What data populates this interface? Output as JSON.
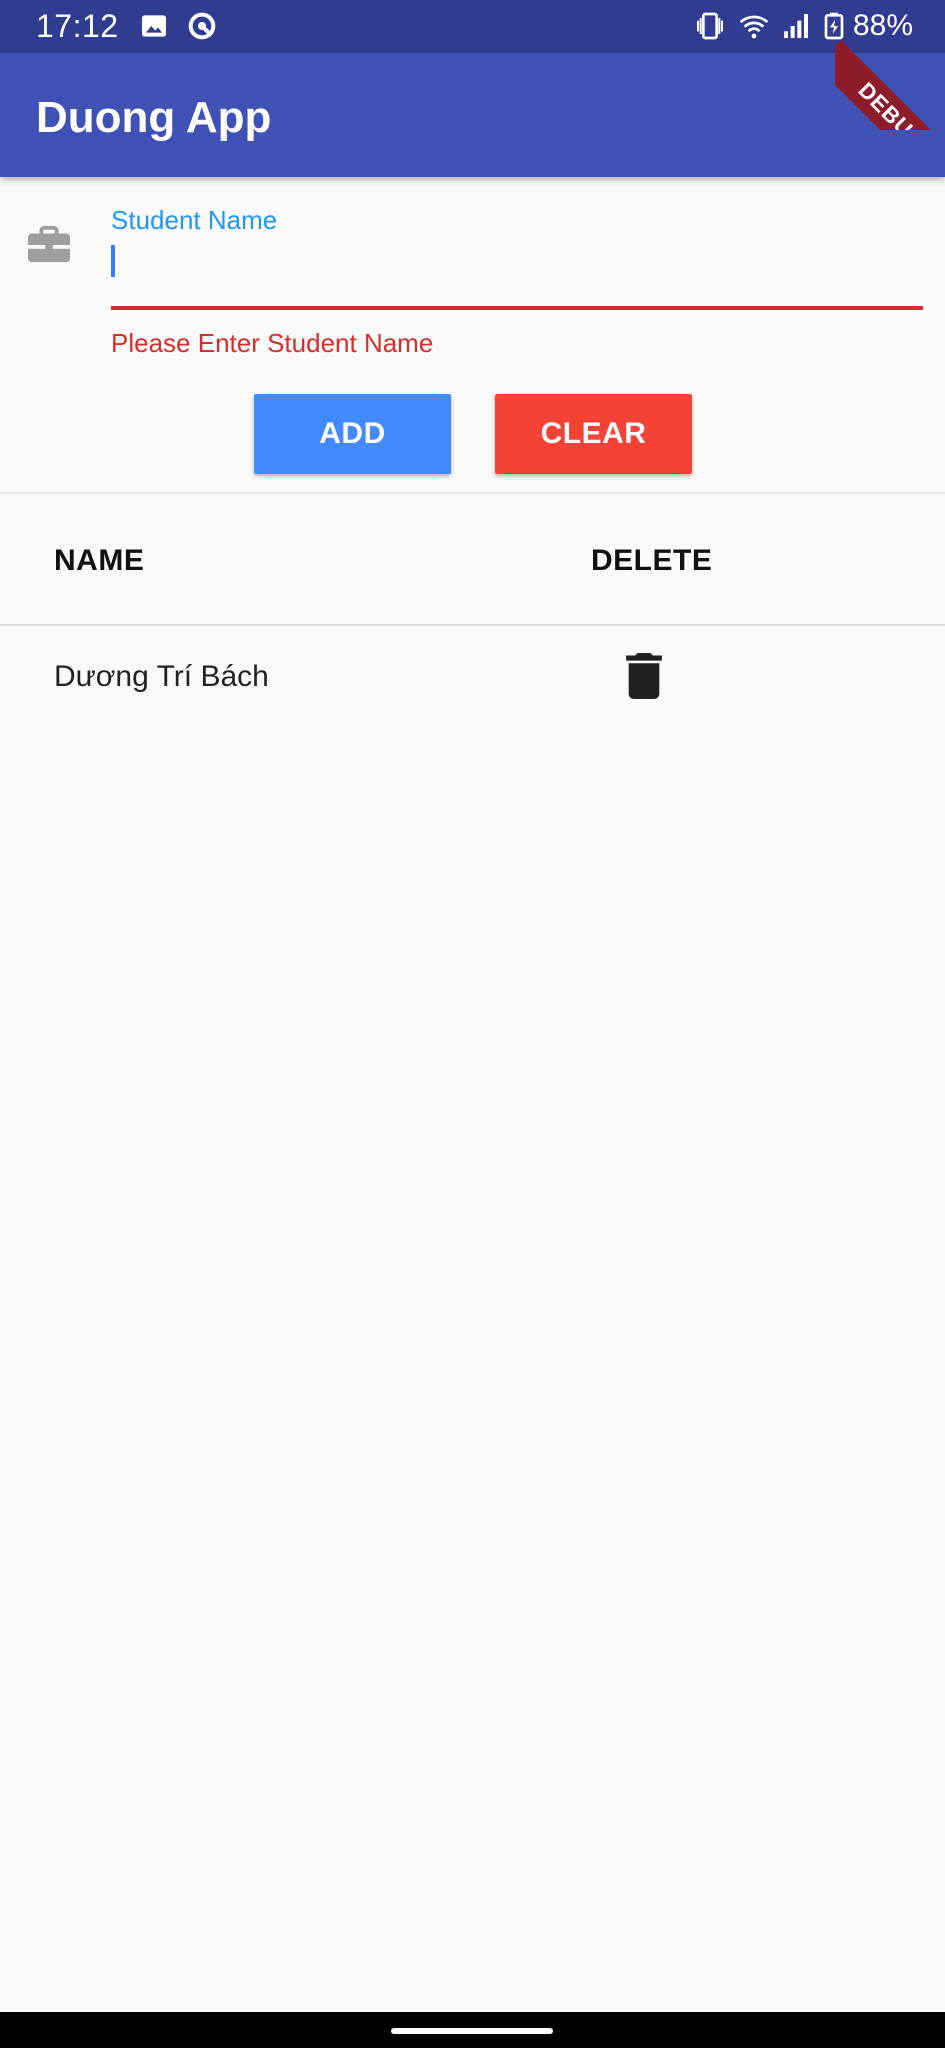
{
  "status_bar": {
    "time": "17:12",
    "battery": "88%",
    "icons": [
      "image-icon",
      "sync-icon",
      "vibrate-icon",
      "wifi-icon",
      "signal-icon",
      "battery-icon"
    ]
  },
  "debug_banner": "DEBUG",
  "app_bar": {
    "title": "Duong App"
  },
  "form": {
    "icon": "briefcase-icon",
    "label": "Student Name",
    "value": "",
    "error": "Please Enter Student Name"
  },
  "buttons": {
    "add": "ADD",
    "clear": "CLEAR"
  },
  "table": {
    "headers": {
      "name": "NAME",
      "delete": "DELETE"
    },
    "rows": [
      {
        "name": "Dương Trí Bách",
        "delete_icon": "trash-icon"
      }
    ]
  },
  "colors": {
    "status_bar": "#2f3c8f",
    "app_bar": "#3f51b5",
    "label": "#2196f3",
    "error": "#d32f2f",
    "add_button": "#448aff",
    "clear_button": "#f44336"
  }
}
